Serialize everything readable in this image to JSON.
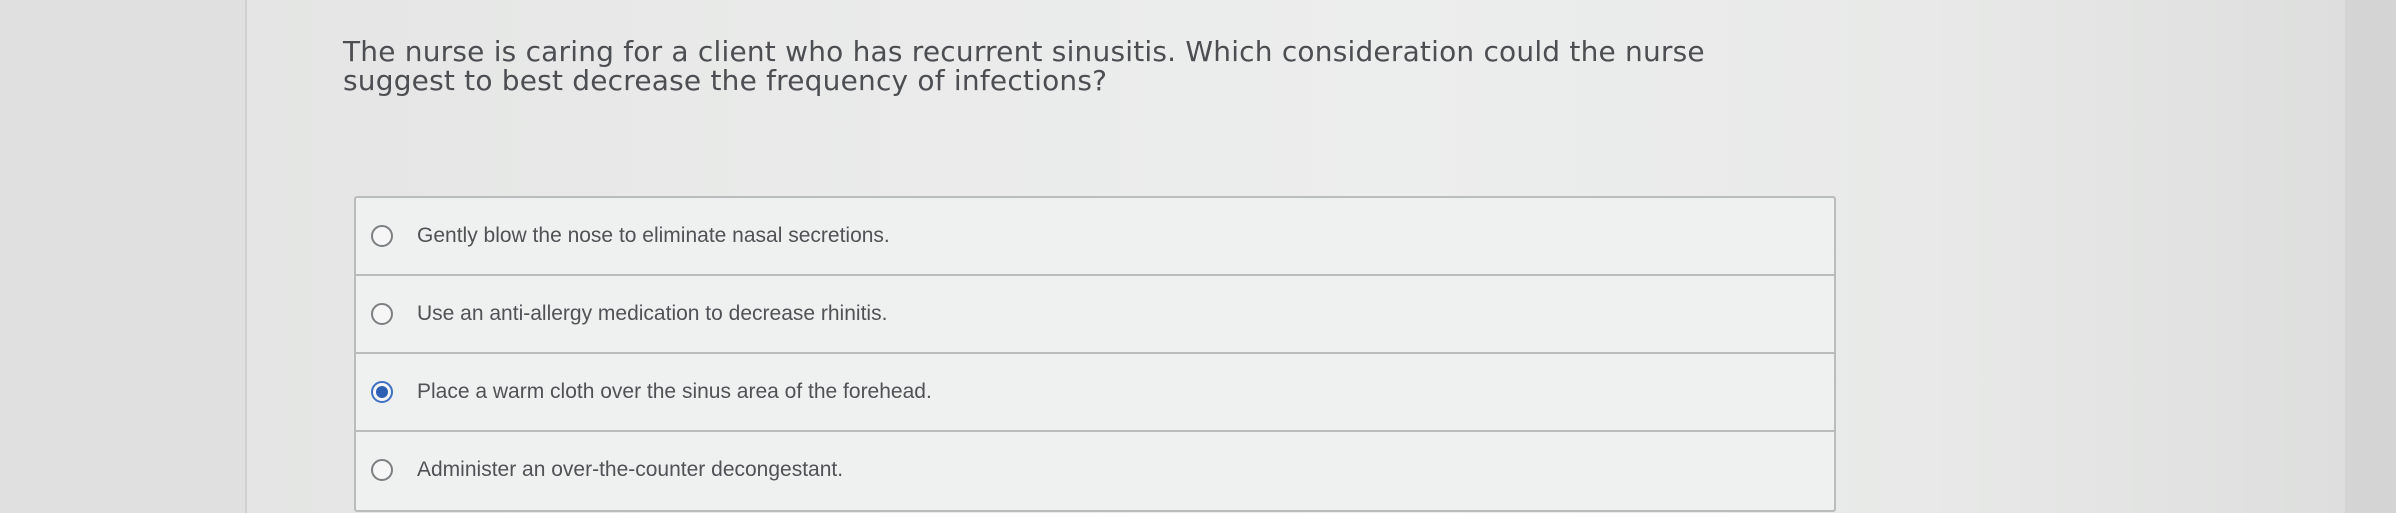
{
  "question": {
    "text": "The nurse is caring for a client who has recurrent sinusitis. Which consideration could the nurse suggest to best decrease the frequency of infections?"
  },
  "options": [
    {
      "label": "Gently blow the nose to eliminate nasal secretions.",
      "selected": false
    },
    {
      "label": "Use an anti-allergy medication to decrease rhinitis.",
      "selected": false
    },
    {
      "label": "Place a warm cloth over the sinus area of the forehead.",
      "selected": true
    },
    {
      "label": "Administer an over-the-counter decongestant.",
      "selected": false
    }
  ],
  "colors": {
    "question_text": "#4c4e52",
    "option_text": "#505256",
    "selected_radio": "#2f5fb4",
    "border": "#b9bbbc"
  }
}
